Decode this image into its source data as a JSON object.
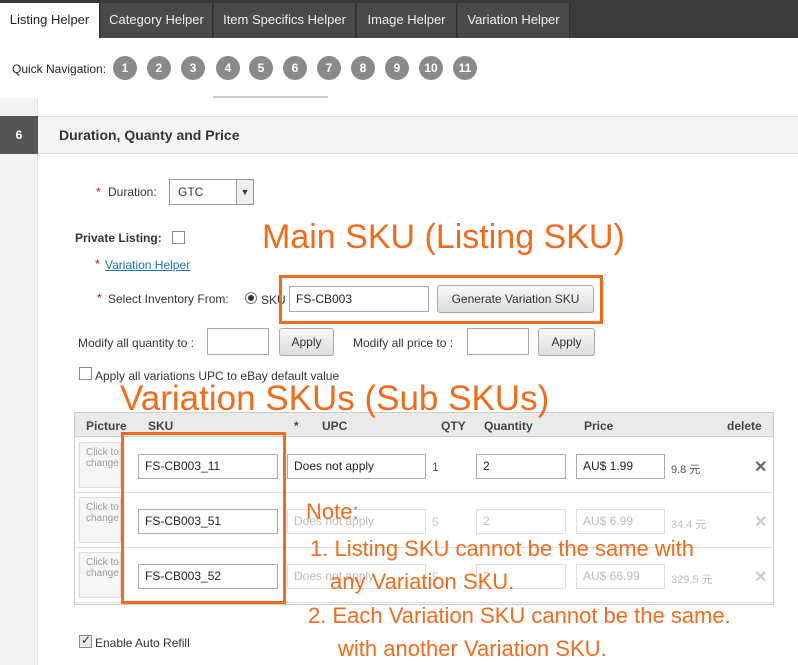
{
  "tabs": [
    {
      "label": "Listing Helper",
      "active": true
    },
    {
      "label": "Category Helper",
      "active": false
    },
    {
      "label": "Item Specifics Helper",
      "active": false
    },
    {
      "label": "Image Helper",
      "active": false
    },
    {
      "label": "Variation Helper",
      "active": false
    }
  ],
  "quick_nav": {
    "label": "Quick Navigation:",
    "items": [
      "1",
      "2",
      "3",
      "4",
      "5",
      "6",
      "7",
      "8",
      "9",
      "10",
      "11"
    ]
  },
  "section": {
    "number": "6",
    "title": "Duration, Quanty and Price"
  },
  "form": {
    "required_mark": "*",
    "duration_label": "Duration:",
    "duration_value": "GTC",
    "private_listing_label": "Private Listing:",
    "variation_helper_link": "Variation Helper",
    "inventory_label": "Select Inventory From:",
    "sku_radio_label": "SKU",
    "sku_value": "FS-CB003",
    "generate_button": "Generate Variation SKU",
    "modify_qty_label": "Modify all quantity to :",
    "modify_price_label": "Modify all price to :",
    "apply_label": "Apply",
    "apply_upc_label": "Apply all variations UPC to eBay default value",
    "enable_auto_refill_label": "Enable Auto Refill"
  },
  "table": {
    "headers": {
      "picture": "Picture",
      "sku": "SKU",
      "upc": "UPC",
      "qty": "QTY",
      "quantity": "Quantity",
      "price": "Price",
      "delete": "delete"
    },
    "picture_text": "Click to change",
    "rows": [
      {
        "sku": "FS-CB003_11",
        "upc": "Does not apply",
        "qty": "1",
        "quantity": "2",
        "price": "AU$ 1.99",
        "cny": "9.8 元",
        "delete": "✕"
      },
      {
        "sku": "FS-CB003_51",
        "upc": "Does not apply",
        "qty": "5",
        "quantity": "2",
        "price": "AU$ 6.99",
        "cny": "34.4 元",
        "delete": "✕"
      },
      {
        "sku": "FS-CB003_52",
        "upc": "Does not apply",
        "qty": "5",
        "quantity": "2",
        "price": "AU$ 66.99",
        "cny": "329.5 元",
        "delete": "✕"
      }
    ]
  },
  "annotations": {
    "main_sku": "Main SKU (Listing SKU)",
    "variation_skus": "Variation SKUs (Sub SKUs)",
    "note_title": "Note:",
    "note_1a": "1. Listing SKU cannot be the same with",
    "note_1b": "any Variation SKU.",
    "note_2a": "2. Each Variation SKU cannot be the same.",
    "note_2b": "with another Variation SKU."
  },
  "colors": {
    "annotation": "#f26a1b",
    "tab_bar": "#3a3a3a",
    "link": "#1a6fb7"
  }
}
